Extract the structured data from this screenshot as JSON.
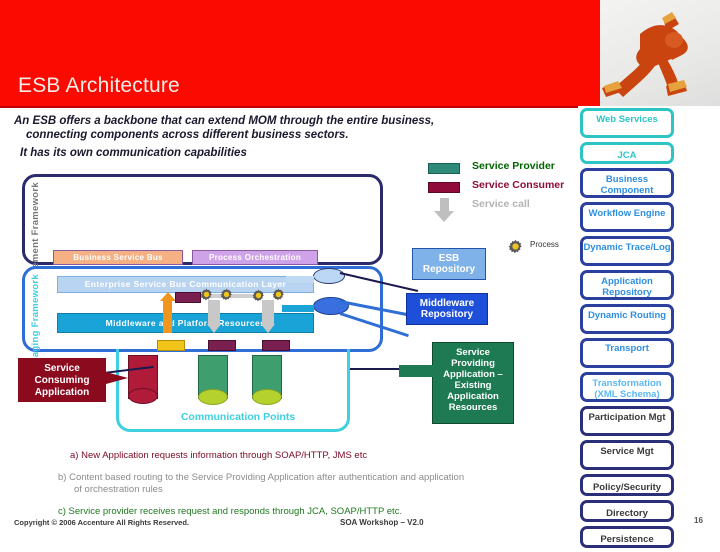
{
  "slide": {
    "title": "ESB Architecture",
    "intro_line1": "An ESB offers a backbone that can extend MOM through the entire business,",
    "intro_line2": "connecting components across different business sectors.",
    "intro_line3": "It has its own communication capabilities"
  },
  "hero": {
    "icon": "speed-skater-photo"
  },
  "legend": {
    "provider": "Service Provider",
    "consumer": "Service Consumer",
    "call": "Service call",
    "provider_color": "#2E8B7A",
    "consumer_color": "#8E0B3A",
    "call_color": "#BFBFBF"
  },
  "diagram": {
    "management_framework": "Management Framework",
    "messaging_framework": "Messaging Framework",
    "business_service_bus": "Business Service Bus",
    "process_orchestration": "Process Orchestration",
    "esb_communication_layer": "Enterprise Service Bus Communication Layer",
    "middleware_platform_resources": "Middleware and Platform Resources",
    "communication_points": "Communication Points",
    "service_consuming_application": "Service Consuming Application",
    "service_providing_application": "Service Providing Application – Existing Application Resources",
    "esb_repository": "ESB Repository",
    "middleware_repository": "Middleware Repository",
    "process_label": "Process"
  },
  "notes": {
    "a": "a) New Application requests information through SOAP/HTTP, JMS etc",
    "b": "b) Content based routing to the Service Providing Application after authentication and application",
    "b_cont": "of orchestration rules",
    "c": "c) Service provider receives request and responds through JCA, SOAP/HTTP etc."
  },
  "footer": {
    "copyright": "Copyright © 2006 Accenture All Rights Reserved.",
    "center": "SOA Workshop – V2.0",
    "page": "16"
  },
  "sidebar": {
    "items": [
      {
        "label": "Web Services",
        "style": "teal"
      },
      {
        "label": "JCA",
        "style": "teal"
      },
      {
        "label": "Business Component",
        "style": "blue"
      },
      {
        "label": "Workflow Engine",
        "style": "blue"
      },
      {
        "label": "Dynamic Trace/Log",
        "style": "blue"
      },
      {
        "label": "Application Repository",
        "style": "blue"
      },
      {
        "label": "Dynamic Routing",
        "style": "blue"
      },
      {
        "label": "Transport",
        "style": "blue"
      },
      {
        "label": "Transformation (XML Schema)",
        "style": "lightblue"
      },
      {
        "label": "Participation Mgt",
        "style": "navy"
      },
      {
        "label": "Service Mgt",
        "style": "navy"
      },
      {
        "label": "Policy/Security",
        "style": "navy"
      },
      {
        "label": "Directory",
        "style": "navy"
      },
      {
        "label": "Persistence",
        "style": "navy"
      }
    ]
  }
}
